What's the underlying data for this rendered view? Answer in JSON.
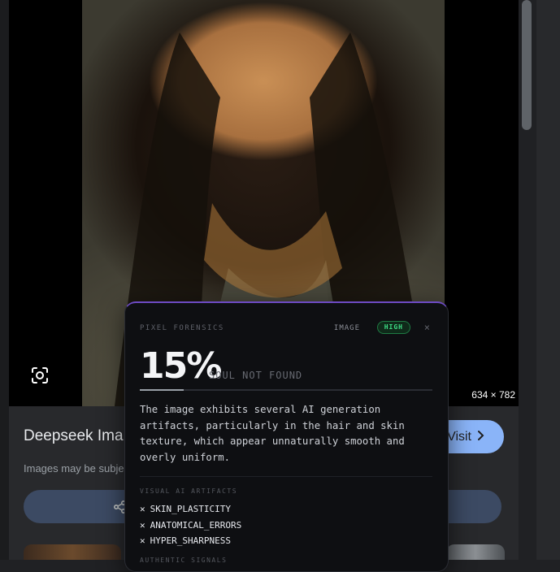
{
  "viewer": {
    "dimensions": "634 × 782",
    "icons": {
      "lens": "lens-scan-icon"
    }
  },
  "result": {
    "site_title": "Deepseek Ima",
    "subject_note": "Images may be subje",
    "visit_label": "Visit",
    "icons": {
      "share": "share-icon",
      "visit_chevron": "chevron-right-icon"
    }
  },
  "forensics": {
    "brand": "PIXEL FORENSICS",
    "media_type": "IMAGE",
    "confidence_badge": "HIGH",
    "close_label": "×",
    "score": "15%",
    "score_fraction": 0.15,
    "verdict": "SOUL NOT FOUND",
    "description": "The image exhibits several AI generation artifacts, particularly in the hair and skin texture, which appear unnaturally smooth and overly uniform.",
    "artifacts_label": "VISUAL AI ARTIFACTS",
    "artifacts": [
      "SKIN_PLASTICITY",
      "ANATOMICAL_ERRORS",
      "HYPER_SHARPNESS"
    ],
    "authentic_label": "AUTHENTIC SIGNALS"
  },
  "colors": {
    "accent_border": "#6d4bc4",
    "badge_green": "#3ddc84",
    "visit_button": "#8ab4f8",
    "page_bg": "#202124"
  }
}
